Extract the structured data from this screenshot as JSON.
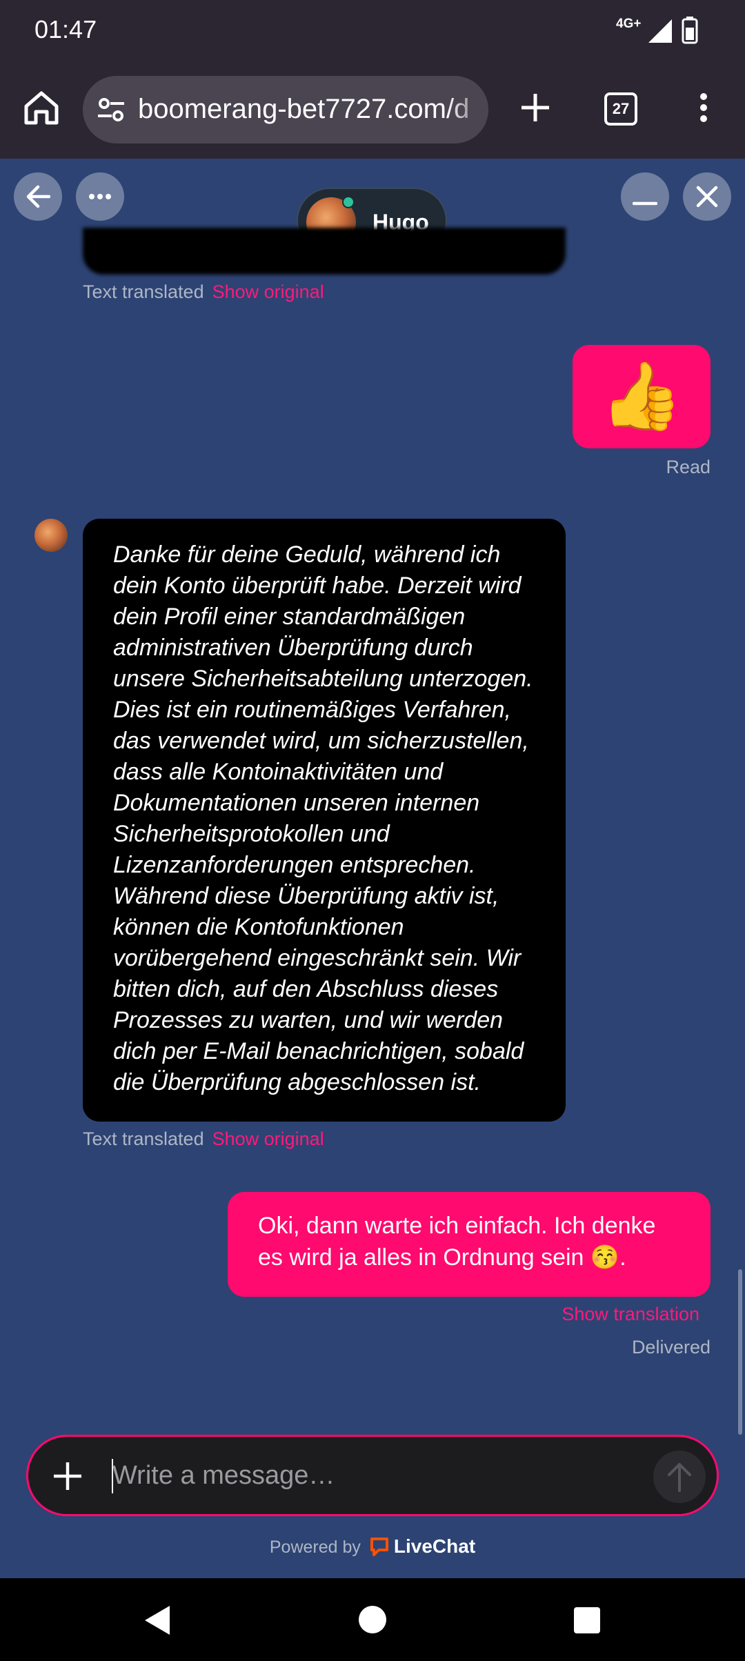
{
  "status_bar": {
    "time": "01:47",
    "network": "4G+"
  },
  "browser": {
    "url": "boomerang-bet7727.com/d",
    "tab_count": "27"
  },
  "chat_header": {
    "agent_name": "Hugo"
  },
  "messages": {
    "earlier_translated_label": "Text translated",
    "earlier_show_original": "Show original",
    "thumbs_emoji": "👍",
    "read_status": "Read",
    "agent_message": "Danke für deine Geduld, während ich dein Konto überprüft habe. Derzeit wird dein Profil einer standardmäßigen administrativen Überprüfung durch unsere Sicherheitsabteilung unterzogen. Dies ist ein routinemäßiges Verfahren, das verwendet wird, um sicherzustellen, dass alle Kontoinaktivitäten und Dokumentationen unseren internen Sicherheitsprotokollen und Lizenzanforderungen entsprechen. Während diese Überprüfung aktiv ist, können die Kontofunktionen vorübergehend eingeschränkt sein. Wir bitten dich, auf den Abschluss dieses Prozesses zu warten, und wir werden dich per E-Mail benachrichtigen, sobald die Überprüfung abgeschlossen ist.",
    "agent_translated_label": "Text translated",
    "agent_show_original": "Show original",
    "user_message": "Oki, dann warte ich einfach. Ich denke es wird ja alles in Ordnung sein 😚.",
    "show_translation": "Show translation",
    "delivered_status": "Delivered"
  },
  "composer": {
    "placeholder": "Write a message…"
  },
  "footer": {
    "powered_by": "Powered by",
    "brand": "LiveChat"
  },
  "colors": {
    "accent": "#ff0a6e",
    "background": "#2d4373",
    "agent_bubble": "#000000"
  }
}
